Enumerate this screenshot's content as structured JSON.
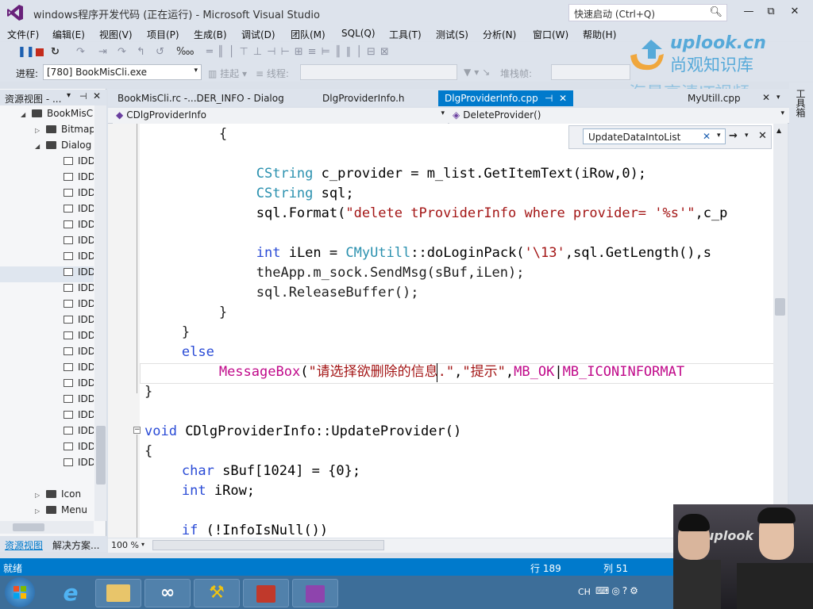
{
  "window": {
    "title": "windows程序开发代码 (正在运行) - Microsoft Visual Studio",
    "quick_launch_placeholder": "快速启动 (Ctrl+Q)",
    "minimize": "—",
    "restore": "⧉",
    "close": "✕"
  },
  "menu": [
    "文件(F)",
    "编辑(E)",
    "视图(V)",
    "项目(P)",
    "生成(B)",
    "调试(D)",
    "团队(M)",
    "SQL(Q)",
    "工具(T)",
    "测试(S)",
    "分析(N)",
    "窗口(W)",
    "帮助(H)"
  ],
  "toolbar": {
    "process_label": "进程:",
    "process_value": "[780] BookMisCli.exe",
    "suspend_label": "挂起",
    "thread_label": "线程:",
    "stack_label": "堆栈帧:"
  },
  "resource_view": {
    "header": "资源视图 - ...",
    "root": "BookMisC",
    "items": [
      "Bitmap",
      "Dialog",
      "IDD",
      "IDD",
      "IDD",
      "IDD",
      "IDD",
      "IDD",
      "IDD",
      "IDD",
      "IDD",
      "IDD",
      "IDD",
      "IDD",
      "IDD",
      "IDD",
      "IDD",
      "IDD",
      "IDD",
      "IDD",
      "IDD",
      "IDD",
      "Icon",
      "Menu"
    ],
    "tabs": [
      "资源视图",
      "解决方案..."
    ]
  },
  "editor_tabs": [
    {
      "label": "BookMisCli.rc -...DER_INFO - Dialog",
      "active": false
    },
    {
      "label": "DlgProviderInfo.h",
      "active": false
    },
    {
      "label": "DlgProviderInfo.cpp",
      "active": true,
      "pin": "⊣",
      "close": "✕"
    },
    {
      "label": "MyUtill.cpp",
      "active": false
    }
  ],
  "navbar": {
    "class_scope": "CDlgProviderInfo",
    "method_scope": "DeleteProvider()"
  },
  "find": {
    "value": "UpdateDataIntoList",
    "clear": "✕",
    "options": "▾",
    "next": "→",
    "close": "✕"
  },
  "code_lines": [
    {
      "indent": 4,
      "text": "{"
    },
    {
      "indent": 0,
      "text": ""
    },
    {
      "indent": 6,
      "parts": [
        [
          "ty",
          "CString"
        ],
        [
          "pu",
          " c_provider = m_list.GetItemText(iRow,0);"
        ]
      ]
    },
    {
      "indent": 6,
      "parts": [
        [
          "ty",
          "CString"
        ],
        [
          "pu",
          " sql;"
        ]
      ]
    },
    {
      "indent": 6,
      "parts": [
        [
          "pu",
          "sql.Format("
        ],
        [
          "st",
          "\"delete tProviderInfo where provider= '%s'\""
        ],
        [
          "pu",
          ",c_p"
        ]
      ]
    },
    {
      "indent": 0,
      "text": ""
    },
    {
      "indent": 6,
      "parts": [
        [
          "kw",
          "int"
        ],
        [
          "pu",
          " iLen = "
        ],
        [
          "ty",
          "CMyUtill"
        ],
        [
          "pu",
          "::doLoginPack("
        ],
        [
          "st",
          "'\\13'"
        ],
        [
          "pu",
          ",sql.GetLength(),s"
        ]
      ]
    },
    {
      "indent": 6,
      "text": "theApp.m_sock.SendMsg(sBuf,iLen);"
    },
    {
      "indent": 6,
      "text": "sql.ReleaseBuffer();"
    },
    {
      "indent": 4,
      "text": "}"
    },
    {
      "indent": 2,
      "text": "}"
    },
    {
      "indent": 2,
      "parts": [
        [
          "kw",
          "else"
        ]
      ]
    },
    {
      "indent": 4,
      "parts": [
        [
          "st2",
          "MessageBox"
        ],
        [
          "pu",
          "("
        ],
        [
          "st",
          "\"请选择欲删除的信息.\""
        ],
        [
          "pu",
          ","
        ],
        [
          "st",
          "\"提示\""
        ],
        [
          "pu",
          ","
        ],
        [
          "st2",
          "MB_OK"
        ],
        [
          "pu",
          "|"
        ],
        [
          "st2",
          "MB_ICONINFORMAT"
        ]
      ]
    },
    {
      "indent": 0,
      "text": "}"
    },
    {
      "indent": 0,
      "text": ""
    },
    {
      "indent": 0,
      "parts": [
        [
          "kw",
          "void"
        ],
        [
          "pu",
          " CDlgProviderInfo::UpdateProvider()"
        ]
      ]
    },
    {
      "indent": 0,
      "text": "{"
    },
    {
      "indent": 2,
      "parts": [
        [
          "kw",
          "char"
        ],
        [
          "pu",
          " sBuf[1024] = {0};"
        ]
      ]
    },
    {
      "indent": 2,
      "parts": [
        [
          "kw",
          "int"
        ],
        [
          "pu",
          " iRow;"
        ]
      ]
    },
    {
      "indent": 0,
      "text": ""
    },
    {
      "indent": 2,
      "parts": [
        [
          "kw",
          "if"
        ],
        [
          "pu",
          " (!InfoIsNull())"
        ]
      ]
    }
  ],
  "zoom": "100 %",
  "status": {
    "ready": "就绪",
    "line": "行 189",
    "col": "列 51"
  },
  "taskbar": {
    "lang": "CH"
  },
  "watermark": {
    "brand": "uplook.cn",
    "cn_name": "尚观知识库",
    "slogan": "海量高清IT视频"
  },
  "right_strip": "工具箱",
  "webcam_logo": "uplook",
  "colors": {
    "accent": "#007acc",
    "keyword": "#2a4bd6",
    "type": "#2b91af",
    "string": "#a31515",
    "macro": "#c00a8a",
    "watermark": "#3fa0d6"
  }
}
